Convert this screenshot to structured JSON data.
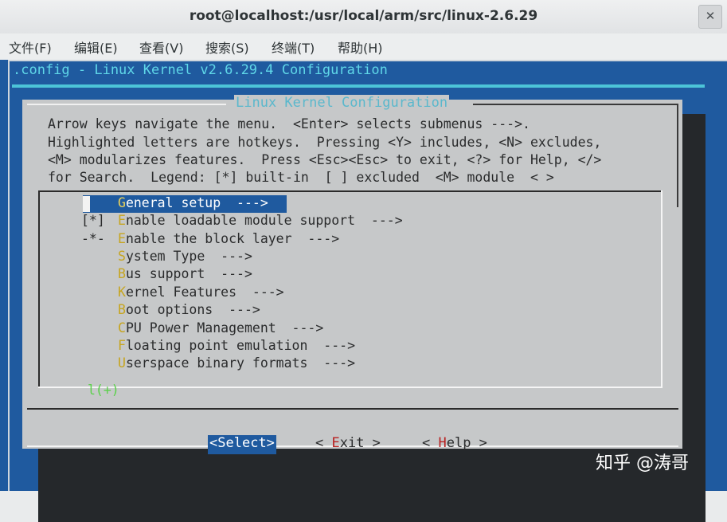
{
  "window": {
    "title": "root@localhost:/usr/local/arm/src/linux-2.6.29",
    "close_glyph": "✕"
  },
  "menubar": {
    "items": [
      "文件(F)",
      "编辑(E)",
      "查看(V)",
      "搜索(S)",
      "终端(T)",
      "帮助(H)"
    ]
  },
  "terminal": {
    "config_title": ".config - Linux Kernel v2.6.29.4 Configuration",
    "dialog_title": "Linux Kernel Configuration",
    "help_lines": [
      "Arrow keys navigate the menu.  <Enter> selects submenus --->.",
      "Highlighted letters are hotkeys.  Pressing <Y> includes, <N> excludes,",
      "<M> modularizes features.  Press <Esc><Esc> to exit, <?> for Help, </>",
      "for Search.  Legend: [*] built-in  [ ] excluded  <M> module  < >"
    ],
    "menu_items": [
      {
        "prefix": "",
        "hotkey": "G",
        "rest": "eneral setup  --->",
        "selected": true
      },
      {
        "prefix": "[*]",
        "hotkey": "E",
        "rest": "nable loadable module support  --->",
        "selected": false
      },
      {
        "prefix": "-*-",
        "hotkey": "E",
        "rest": "nable the block layer  --->",
        "selected": false
      },
      {
        "prefix": "",
        "hotkey": "S",
        "rest": "ystem Type  --->",
        "selected": false
      },
      {
        "prefix": "",
        "hotkey": "B",
        "rest": "us support  --->",
        "selected": false
      },
      {
        "prefix": "",
        "hotkey": "K",
        "rest": "ernel Features  --->",
        "selected": false
      },
      {
        "prefix": "",
        "hotkey": "B",
        "rest": "oot options  --->",
        "selected": false
      },
      {
        "prefix": "",
        "hotkey": "C",
        "rest": "PU Power Management  --->",
        "selected": false
      },
      {
        "prefix": "",
        "hotkey": "F",
        "rest": "loating point emulation  --->",
        "selected": false
      },
      {
        "prefix": "",
        "hotkey": "U",
        "rest": "serspace binary formats  --->",
        "selected": false
      }
    ],
    "more_indicator": "l(+)",
    "buttons": {
      "select": {
        "pre": "<",
        "hot": "S",
        "rest": "elect>"
      },
      "exit": {
        "pre": "< ",
        "hot": "E",
        "rest": "xit >"
      },
      "help": {
        "pre": "< ",
        "hot": "H",
        "rest": "elp >"
      }
    }
  },
  "watermark": "知乎 @涛哥",
  "colors": {
    "terminal_bg": "#1f5a9f",
    "dialog_bg": "#c6c8c9",
    "title_cyan": "#5fd7e8",
    "hotkey_yellow": "#c6a520",
    "button_hot_red": "#b82020",
    "indicator_green": "#5ad14a"
  }
}
